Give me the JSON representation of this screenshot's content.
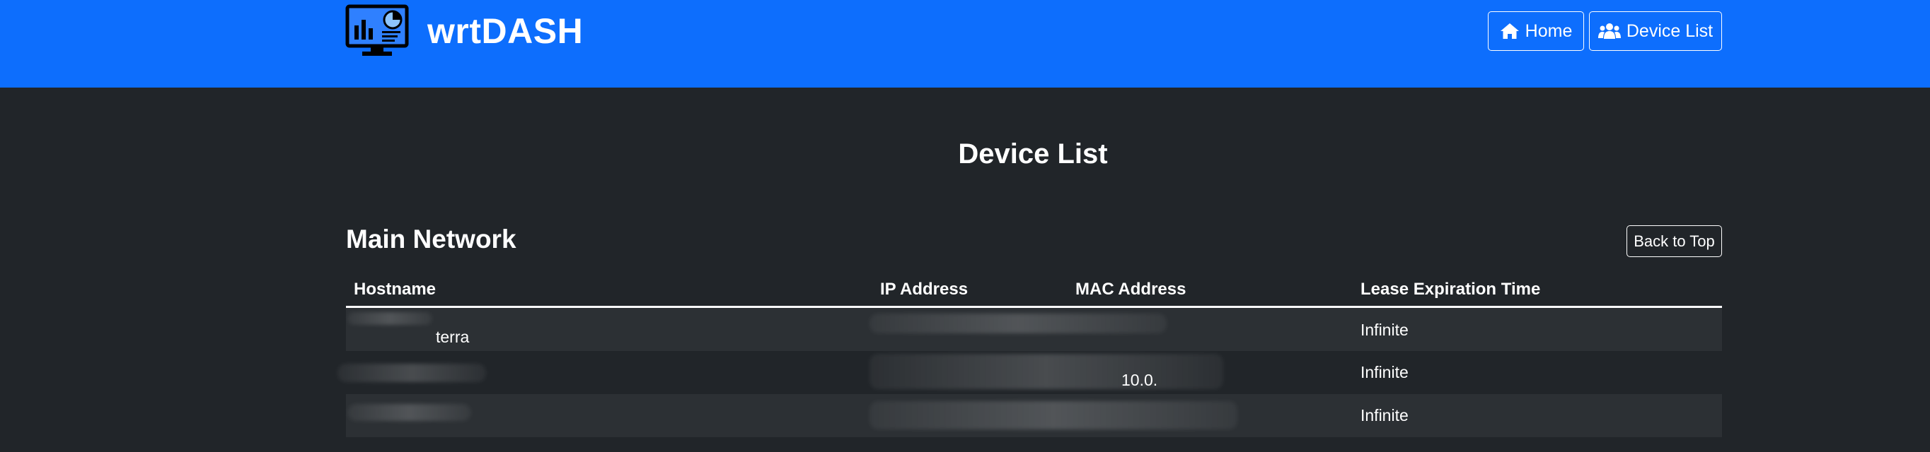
{
  "brand": {
    "name": "wrtDASH",
    "logo_icon": "dashboard-monitor-icon"
  },
  "nav": {
    "home_label": "Home",
    "device_list_label": "Device List",
    "home_icon": "house-icon",
    "device_list_icon": "users-icon"
  },
  "page": {
    "title": "Device List"
  },
  "section": {
    "title": "Main Network",
    "back_to_top_label": "Back to Top"
  },
  "table": {
    "columns": [
      "Hostname",
      "IP Address",
      "MAC Address",
      "Lease Expiration Time"
    ],
    "rows": [
      {
        "hostname": "terra",
        "ip": "",
        "mac": "",
        "lease": "Infinite"
      },
      {
        "hostname": "",
        "ip": "10.0.",
        "mac": "",
        "lease": "Infinite"
      },
      {
        "hostname": "",
        "ip": "",
        "mac": "",
        "lease": "Infinite"
      }
    ]
  },
  "colors": {
    "navbar": "#0d6efd",
    "page_background": "#212529",
    "striped_row": "#2c3034",
    "text": "#ffffff"
  }
}
